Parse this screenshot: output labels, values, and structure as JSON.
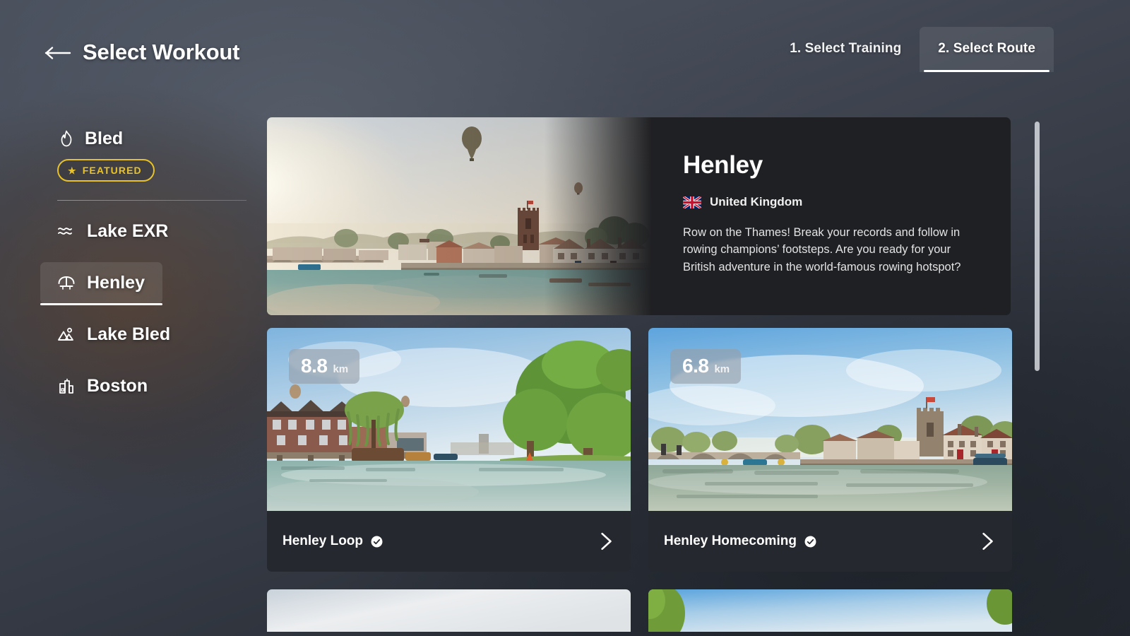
{
  "header": {
    "back_icon": "arrow-left-icon",
    "title": "Select Workout",
    "steps": [
      {
        "label": "1. Select Training",
        "active": false
      },
      {
        "label": "2. Select Route",
        "active": true
      }
    ]
  },
  "sidebar": {
    "featured": {
      "icon": "flame-icon",
      "name": "Bled",
      "badge_label": "FEATURED",
      "badge_star": "★",
      "badge_color": "#e8c22a"
    },
    "items": [
      {
        "label": "Lake EXR",
        "icon": "waves-icon",
        "selected": false
      },
      {
        "label": "Henley",
        "icon": "bridge-icon",
        "selected": true
      },
      {
        "label": "Lake Bled",
        "icon": "mountain-icon",
        "selected": false
      },
      {
        "label": "Boston",
        "icon": "building-icon",
        "selected": false
      }
    ]
  },
  "detail": {
    "title": "Henley",
    "country": "United Kingdom",
    "country_flag": "uk-flag-icon",
    "description": "Row on the Thames! Break your records and follow in rowing champions’ footsteps. Are you ready for your British adventure in the world-famous rowing hotspot?"
  },
  "routes": [
    {
      "name": "Henley Loop",
      "distance_value": "8.8",
      "distance_unit": "km",
      "verified": true,
      "chevron": "chevron-right-icon"
    },
    {
      "name": "Henley Homecoming",
      "distance_value": "6.8",
      "distance_unit": "km",
      "verified": true,
      "chevron": "chevron-right-icon"
    }
  ],
  "scrollbar": {
    "thumb_color": "#e1e4e8"
  }
}
